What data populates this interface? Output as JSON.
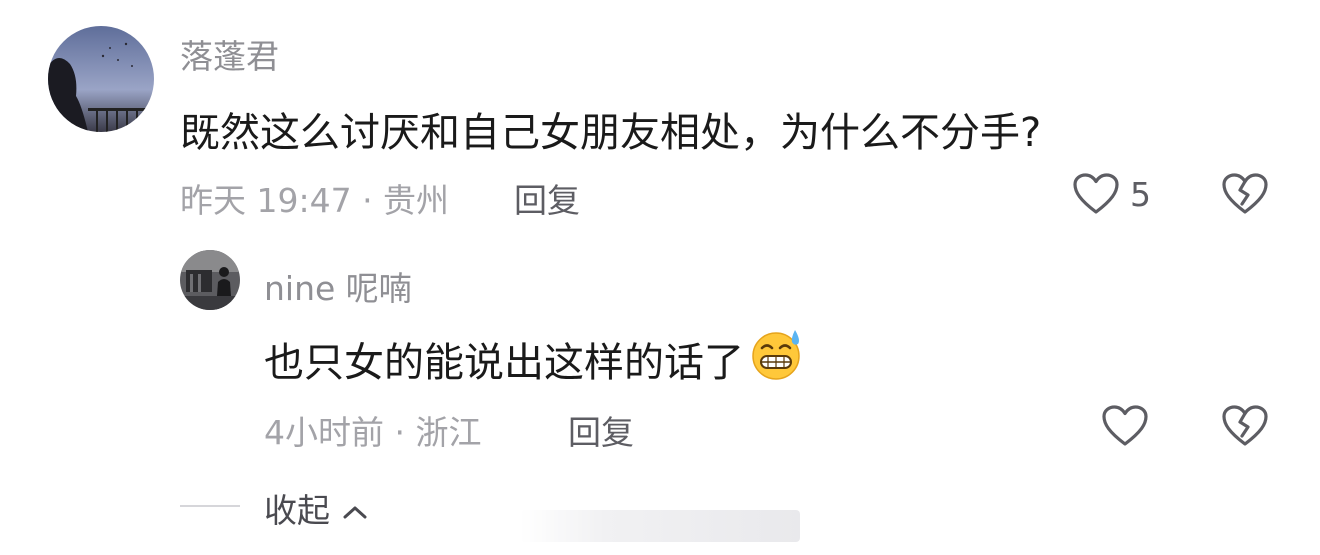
{
  "comments": [
    {
      "user": "落蓬君",
      "text": "既然这么讨厌和自己女朋友相处，为什么不分手?",
      "time_location": "昨天 19:47 · 贵州",
      "reply_label": "回复",
      "likes": "5"
    }
  ],
  "reply": {
    "user": "nine 呢喃",
    "text": "也只女的能说出这样的话了",
    "time_location": "4小时前 · 浙江",
    "reply_label": "回复"
  },
  "collapse_label": "收起",
  "icons": {
    "like": "heart-outline-icon",
    "dislike": "broken-heart-icon",
    "collapse": "chevron-up-icon",
    "emoji": "grimacing-sweat-emoji-icon"
  },
  "colors": {
    "username": "#8f8f94",
    "text": "#1a1a1a",
    "meta": "#a3a3a8",
    "icon": "#5d5d63"
  }
}
